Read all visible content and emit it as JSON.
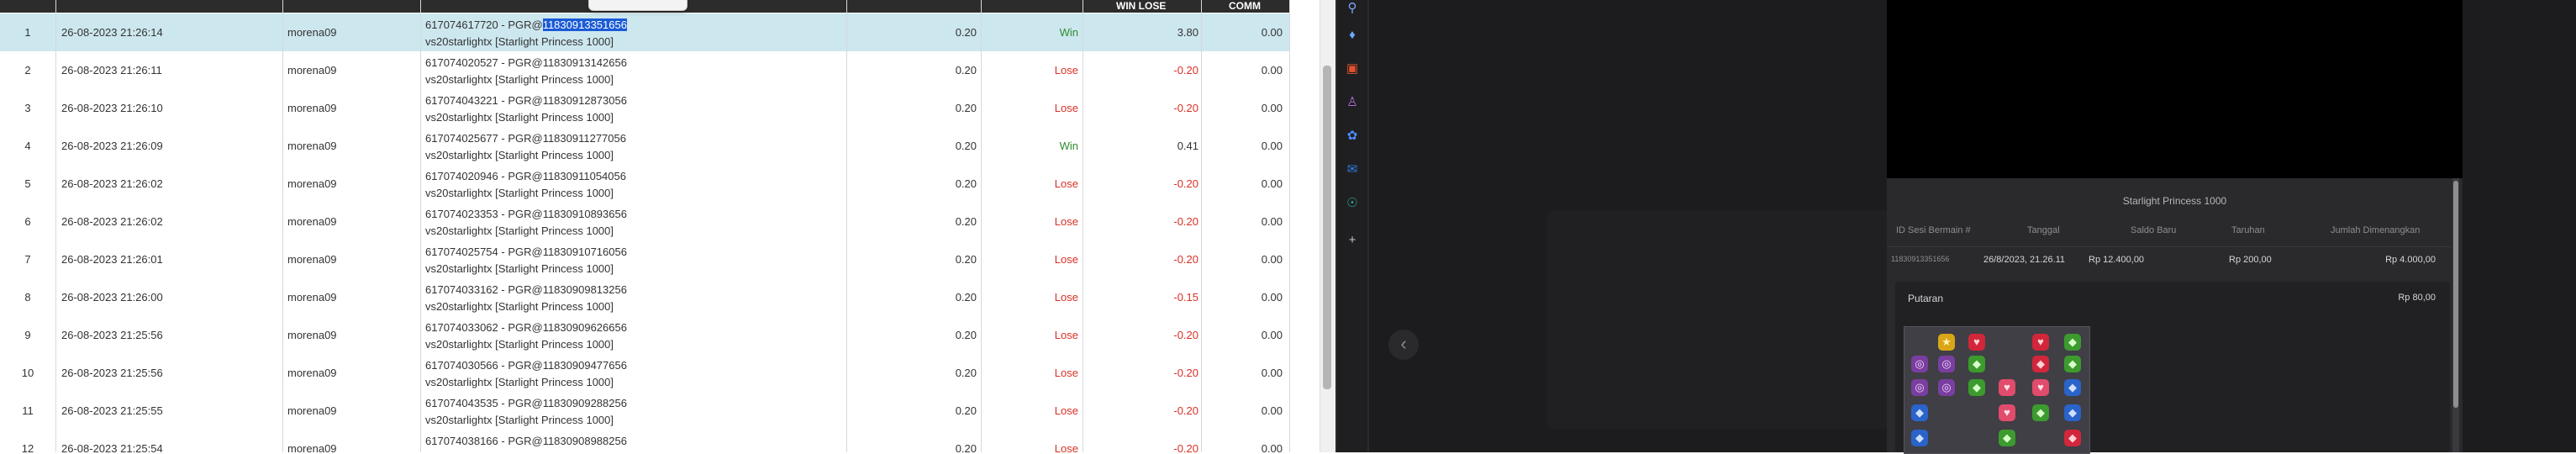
{
  "table": {
    "headers": {
      "win_lose": "WIN LOSE",
      "comm": "COMM"
    },
    "rows": [
      {
        "no": "1",
        "date": "26-08-2023 21:26:14",
        "user": "morena09",
        "desc_prefix": "617074617720 - PGR@",
        "desc_id": "11830913351656",
        "desc_line2": "vs20starlightx [Starlight Princess 1000]",
        "bet": "0.20",
        "status": "Win",
        "win_lose": "3.80",
        "comm": "0.00"
      },
      {
        "no": "2",
        "date": "26-08-2023 21:26:11",
        "user": "morena09",
        "desc_prefix": "617074020527 - PGR@",
        "desc_id": "11830913142656",
        "desc_line2": "vs20starlightx [Starlight Princess 1000]",
        "bet": "0.20",
        "status": "Lose",
        "win_lose": "-0.20",
        "comm": "0.00"
      },
      {
        "no": "3",
        "date": "26-08-2023 21:26:10",
        "user": "morena09",
        "desc_prefix": "617074043221 - PGR@",
        "desc_id": "11830912873056",
        "desc_line2": "vs20starlightx [Starlight Princess 1000]",
        "bet": "0.20",
        "status": "Lose",
        "win_lose": "-0.20",
        "comm": "0.00"
      },
      {
        "no": "4",
        "date": "26-08-2023 21:26:09",
        "user": "morena09",
        "desc_prefix": "617074025677 - PGR@",
        "desc_id": "11830911277056",
        "desc_line2": "vs20starlightx [Starlight Princess 1000]",
        "bet": "0.20",
        "status": "Win",
        "win_lose": "0.41",
        "comm": "0.00"
      },
      {
        "no": "5",
        "date": "26-08-2023 21:26:02",
        "user": "morena09",
        "desc_prefix": "617074020946 - PGR@",
        "desc_id": "11830911054056",
        "desc_line2": "vs20starlightx [Starlight Princess 1000]",
        "bet": "0.20",
        "status": "Lose",
        "win_lose": "-0.20",
        "comm": "0.00"
      },
      {
        "no": "6",
        "date": "26-08-2023 21:26:02",
        "user": "morena09",
        "desc_prefix": "617074023353 - PGR@",
        "desc_id": "11830910893656",
        "desc_line2": "vs20starlightx [Starlight Princess 1000]",
        "bet": "0.20",
        "status": "Lose",
        "win_lose": "-0.20",
        "comm": "0.00"
      },
      {
        "no": "7",
        "date": "26-08-2023 21:26:01",
        "user": "morena09",
        "desc_prefix": "617074025754 - PGR@",
        "desc_id": "11830910716056",
        "desc_line2": "vs20starlightx [Starlight Princess 1000]",
        "bet": "0.20",
        "status": "Lose",
        "win_lose": "-0.20",
        "comm": "0.00"
      },
      {
        "no": "8",
        "date": "26-08-2023 21:26:00",
        "user": "morena09",
        "desc_prefix": "617074033162 - PGR@",
        "desc_id": "11830909813256",
        "desc_line2": "vs20starlightx [Starlight Princess 1000]",
        "bet": "0.20",
        "status": "Lose",
        "win_lose": "-0.15",
        "comm": "0.00"
      },
      {
        "no": "9",
        "date": "26-08-2023 21:25:56",
        "user": "morena09",
        "desc_prefix": "617074033062 - PGR@",
        "desc_id": "11830909626656",
        "desc_line2": "vs20starlightx [Starlight Princess 1000]",
        "bet": "0.20",
        "status": "Lose",
        "win_lose": "-0.20",
        "comm": "0.00"
      },
      {
        "no": "10",
        "date": "26-08-2023 21:25:56",
        "user": "morena09",
        "desc_prefix": "617074030566 - PGR@",
        "desc_id": "11830909477656",
        "desc_line2": "vs20starlightx [Starlight Princess 1000]",
        "bet": "0.20",
        "status": "Lose",
        "win_lose": "-0.20",
        "comm": "0.00"
      },
      {
        "no": "11",
        "date": "26-08-2023 21:25:55",
        "user": "morena09",
        "desc_prefix": "617074043535 - PGR@",
        "desc_id": "11830909288256",
        "desc_line2": "vs20starlightx [Starlight Princess 1000]",
        "bet": "0.20",
        "status": "Lose",
        "win_lose": "-0.20",
        "comm": "0.00"
      },
      {
        "no": "12",
        "date": "26-08-2023 21:25:54",
        "user": "morena09",
        "desc_prefix": "617074038166 - PGR@",
        "desc_id": "11830908988256",
        "desc_line2": "vs20starlightx [Starlight Princess 1000]",
        "bet": "0.20",
        "status": "Lose",
        "win_lose": "-0.20",
        "comm": "0.00"
      }
    ]
  },
  "sidebar_icons": [
    "search-icon",
    "tag-icon",
    "toolbox-icon",
    "user-icon",
    "gear-flower-icon",
    "outlook-icon",
    "cart-icon",
    "plus-icon"
  ],
  "game": {
    "title": "Starlight Princess 1000",
    "columns": {
      "id": "ID Sesi Bermain #",
      "date": "Tanggal",
      "balance": "Saldo Baru",
      "bet": "Taruhan",
      "win": "Jumlah Dimenangkan"
    },
    "row": {
      "id": "11830913351656",
      "date": "26/8/2023, 21.26.11",
      "balance": "Rp 12.400,00",
      "bet": "Rp 200,00",
      "win": "Rp 4.000,00"
    },
    "putaran": {
      "label": "Putaran",
      "value": "Rp 80,00"
    }
  },
  "colors": {
    "selected_row": "#cde7ef",
    "win": "#2e8b2e",
    "lose": "#d93025",
    "highlight": "#1a5bd6"
  }
}
